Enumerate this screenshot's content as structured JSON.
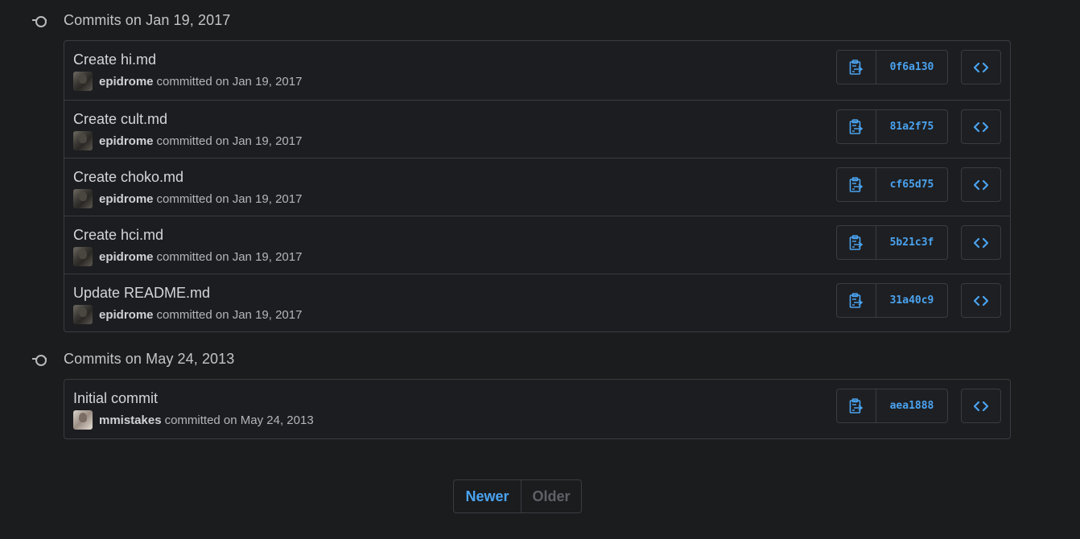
{
  "colors": {
    "accent": "#4aa3f0",
    "background": "#1b1c1e",
    "border": "#3a3c40"
  },
  "groups": [
    {
      "title": "Commits on Jan 19, 2017",
      "commits": [
        {
          "message": "Create hi.md",
          "author": "epidrome",
          "meta": "committed on Jan 19, 2017",
          "sha": "0f6a130",
          "avatar": "dark"
        },
        {
          "message": "Create cult.md",
          "author": "epidrome",
          "meta": "committed on Jan 19, 2017",
          "sha": "81a2f75",
          "avatar": "dark"
        },
        {
          "message": "Create choko.md",
          "author": "epidrome",
          "meta": "committed on Jan 19, 2017",
          "sha": "cf65d75",
          "avatar": "dark"
        },
        {
          "message": "Create hci.md",
          "author": "epidrome",
          "meta": "committed on Jan 19, 2017",
          "sha": "5b21c3f",
          "avatar": "dark"
        },
        {
          "message": "Update README.md",
          "author": "epidrome",
          "meta": "committed on Jan 19, 2017",
          "sha": "31a40c9",
          "avatar": "dark"
        }
      ]
    },
    {
      "title": "Commits on May 24, 2013",
      "commits": [
        {
          "message": "Initial commit",
          "author": "mmistakes",
          "meta": "committed on May 24, 2013",
          "sha": "aea1888",
          "avatar": "light"
        }
      ]
    }
  ],
  "pagination": {
    "newer": "Newer",
    "older": "Older"
  },
  "icons": {
    "copy": "clippy-icon",
    "browse": "code-icon",
    "group": "git-commit-icon"
  }
}
